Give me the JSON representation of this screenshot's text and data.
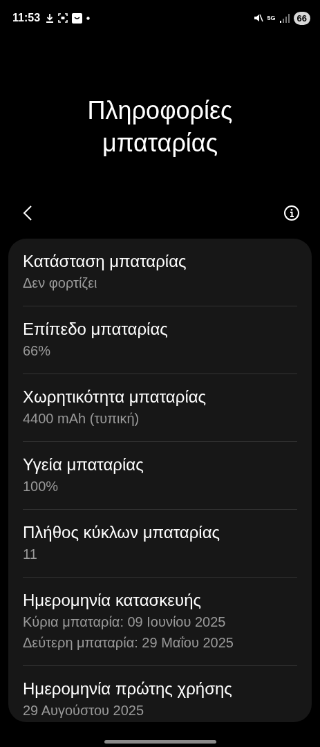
{
  "status_bar": {
    "time": "11:53",
    "network": "5G",
    "battery": "66"
  },
  "title": "Πληροφορίες μπαταρίας",
  "rows": [
    {
      "label": "Κατάσταση μπαταρίας",
      "values": [
        "Δεν φορτίζει"
      ]
    },
    {
      "label": "Επίπεδο μπαταρίας",
      "values": [
        "66%"
      ]
    },
    {
      "label": "Χωρητικότητα μπαταρίας",
      "values": [
        "4400 mAh (τυπική)"
      ]
    },
    {
      "label": "Υγεία μπαταρίας",
      "values": [
        "100%"
      ]
    },
    {
      "label": "Πλήθος κύκλων μπαταρίας",
      "values": [
        "11"
      ]
    },
    {
      "label": "Ημερομηνία κατασκευής",
      "values": [
        "Κύρια μπαταρία: 09 Ιουνίου 2025",
        "Δεύτερη μπαταρία: 29 Μαΐου 2025"
      ]
    },
    {
      "label": "Ημερομηνία πρώτης χρήσης",
      "values": [
        "29 Αυγούστου 2025"
      ]
    }
  ]
}
